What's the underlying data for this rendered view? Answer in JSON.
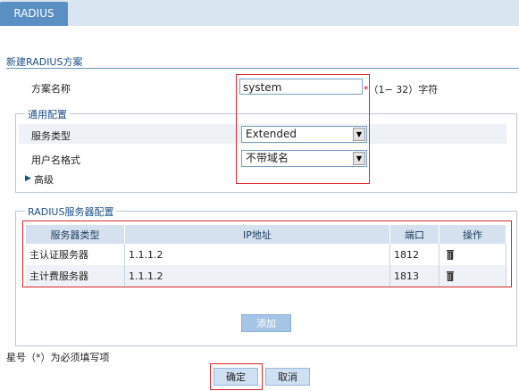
{
  "tab": {
    "label": "RADIUS"
  },
  "page_title": "新建RADIUS方案",
  "scheme_name": {
    "label": "方案名称",
    "value": "system",
    "required_mark": "*",
    "hint": "（1− 32）字符"
  },
  "general": {
    "legend": "通用配置",
    "service_type": {
      "label": "服务类型",
      "value": "Extended"
    },
    "username_format": {
      "label": "用户名格式",
      "value": "不带域名"
    },
    "advanced_label": "高级"
  },
  "servers": {
    "legend": "RADIUS服务器配置",
    "columns": [
      "服务器类型",
      "IP地址",
      "端口",
      "操作"
    ],
    "rows": [
      {
        "type": "主认证服务器",
        "ip": "1.1.1.2",
        "port": "1812"
      },
      {
        "type": "主计费服务器",
        "ip": "1.1.1.2",
        "port": "1813"
      }
    ],
    "add_label": "添加"
  },
  "footnote": "星号（*）为必须填写项",
  "actions": {
    "ok": "确定",
    "cancel": "取消"
  },
  "colors": {
    "accent": "#5a8fc4",
    "highlight": "#d9262b",
    "band": "#eef2f6"
  }
}
